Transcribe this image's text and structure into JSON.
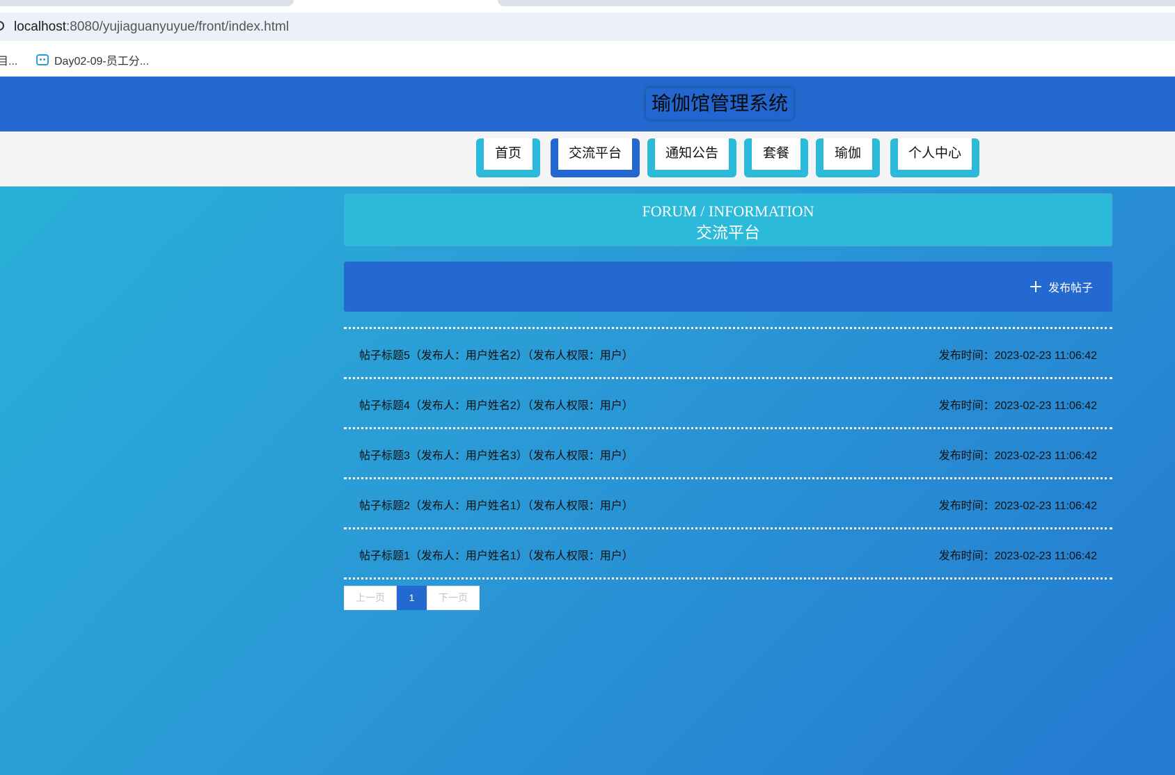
{
  "browser": {
    "url_host": "localhost",
    "url_rest": ":8080/yujiaguanyuyue/front/index.html",
    "bookmarks": [
      {
        "label": "目..."
      },
      {
        "label": "Day02-09-员工分..."
      }
    ]
  },
  "site": {
    "title": "瑜伽馆管理系统"
  },
  "nav": {
    "items": [
      {
        "label": "首页",
        "active": false
      },
      {
        "label": "交流平台",
        "active": true
      },
      {
        "label": "通知公告",
        "active": false
      },
      {
        "label": "套餐",
        "active": false
      },
      {
        "label": "瑜伽",
        "active": false
      },
      {
        "label": "个人中心",
        "active": false
      }
    ]
  },
  "forum": {
    "title_en": "FORUM / INFORMATION",
    "title_zh": "交流平台",
    "publish_label": "发布帖子",
    "posts": [
      {
        "title": "帖子标题5（发布人：用户姓名2）（发布人权限：用户）",
        "time": "发布时间：2023-02-23 11:06:42"
      },
      {
        "title": "帖子标题4（发布人：用户姓名2）（发布人权限：用户）",
        "time": "发布时间：2023-02-23 11:06:42"
      },
      {
        "title": "帖子标题3（发布人：用户姓名3）（发布人权限：用户）",
        "time": "发布时间：2023-02-23 11:06:42"
      },
      {
        "title": "帖子标题2（发布人：用户姓名1）（发布人权限：用户）",
        "time": "发布时间：2023-02-23 11:06:42"
      },
      {
        "title": "帖子标题1（发布人：用户姓名1）（发布人权限：用户）",
        "time": "发布时间：2023-02-23 11:06:42"
      }
    ]
  },
  "pagination": {
    "prev_label": "上一页",
    "current_page": "1",
    "next_label": "下一页"
  },
  "colors": {
    "header_bg": "#2469cf",
    "accent_cyan": "#2bbad9",
    "nav_bg": "#f5f5f5"
  }
}
